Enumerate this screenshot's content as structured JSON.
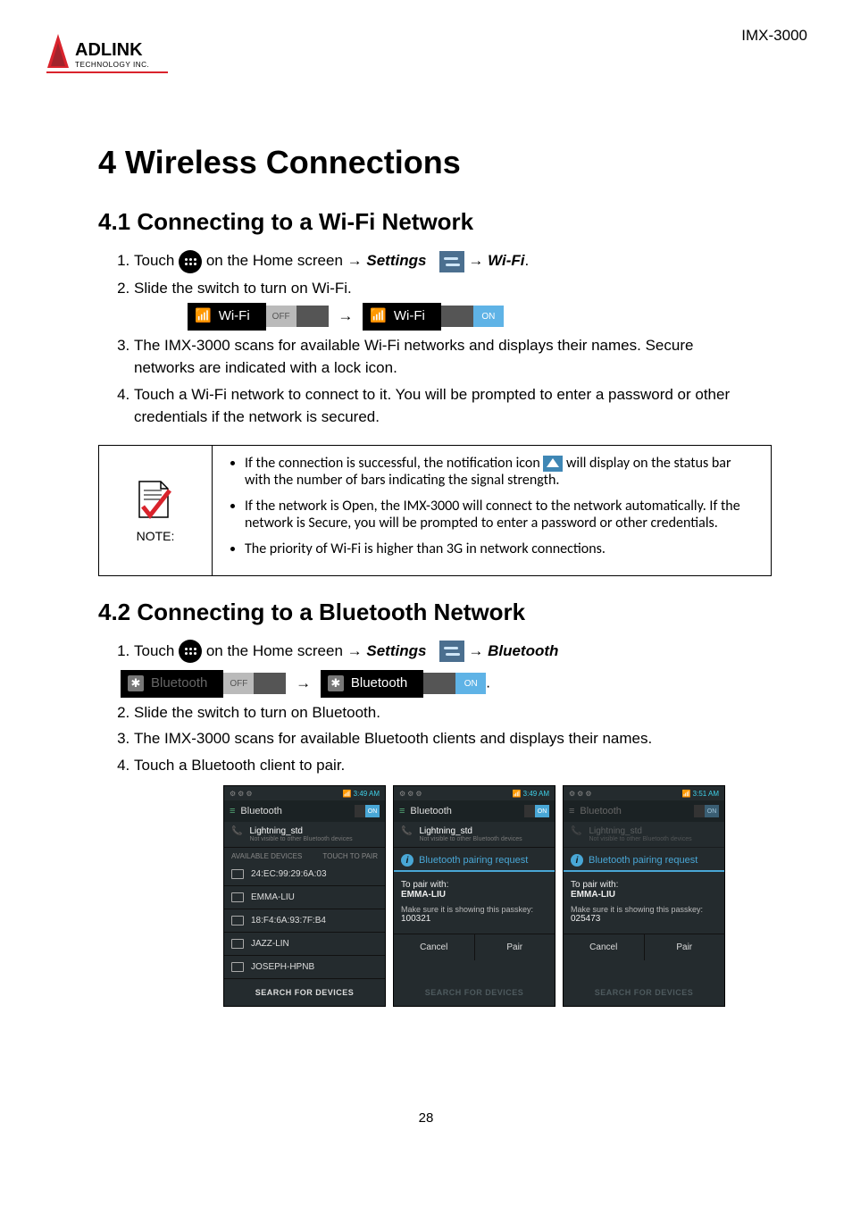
{
  "header": {
    "product": "IMX-3000",
    "logo_top": "ADLINK",
    "logo_bottom": "TECHNOLOGY INC."
  },
  "page_number": "28",
  "h1": "4 Wireless Connections",
  "section41": {
    "title": "4.1 Connecting to a Wi-Fi Network",
    "step1_a": "Touch ",
    "step1_b": " on the Home screen → ",
    "settings": "Settings",
    "step1_c": " → ",
    "wifi": "Wi-Fi",
    "step1_d": ".",
    "step2": "Slide the switch to turn on Wi-Fi.",
    "wifi_label": "Wi-Fi",
    "off": "OFF",
    "on": "ON",
    "step3": "The IMX-3000 scans for available Wi-Fi networks and displays their names. Secure networks are indicated with a lock icon.",
    "step4": "Touch a Wi-Fi network to connect to it. You will be prompted to enter a password or other credentials if the network is secured."
  },
  "note": {
    "caption": "NOTE:",
    "b1_a": "If the connection is successful, the notification icon ",
    "b1_b": " will display on the status bar with the number of bars indicating the signal strength.",
    "b2": "If the network is Open, the IMX-3000 will connect to the network automatically. If the network is Secure, you will be prompted to enter a password or other credentials.",
    "b3": "The priority of Wi-Fi is higher than 3G in network connections."
  },
  "section42": {
    "title": "4.2 Connecting to a Bluetooth Network",
    "step1_a": "Touch ",
    "step1_b": " on the Home screen → ",
    "settings": "Settings",
    "step1_c": " → ",
    "bluetooth": "Bluetooth",
    "bt_label": "Bluetooth",
    "off": "OFF",
    "on": "ON",
    "step2": "Slide the switch to turn on Bluetooth.",
    "step3": "The IMX-3000 scans for available Bluetooth clients and displays their names.",
    "step4": "Touch a Bluetooth client to pair."
  },
  "shots": {
    "status_right_a": "3:49 AM",
    "status_right_b": "3:49 AM",
    "status_right_c": "3:51 AM",
    "title": "Bluetooth",
    "on": "ON",
    "device": "Lightning_std",
    "device_sub": "Not visible to other Bluetooth devices",
    "avail": "AVAILABLE DEVICES",
    "touch": "TOUCH TO PAIR",
    "d1": "24:EC:99:29:6A:03",
    "d2": "EMMA-LIU",
    "d3": "18:F4:6A:93:7F:B4",
    "d4": "JAZZ-LIN",
    "d5": "JOSEPH-HPNB",
    "search": "SEARCH FOR DEVICES",
    "pair_req": "Bluetooth pairing request",
    "pair_with": "To pair with:",
    "pair_dev": "EMMA-LIU",
    "pass_label": "Make sure it is showing this passkey:",
    "pass1": "100321",
    "pass2": "025473",
    "cancel": "Cancel",
    "pair": "Pair"
  }
}
